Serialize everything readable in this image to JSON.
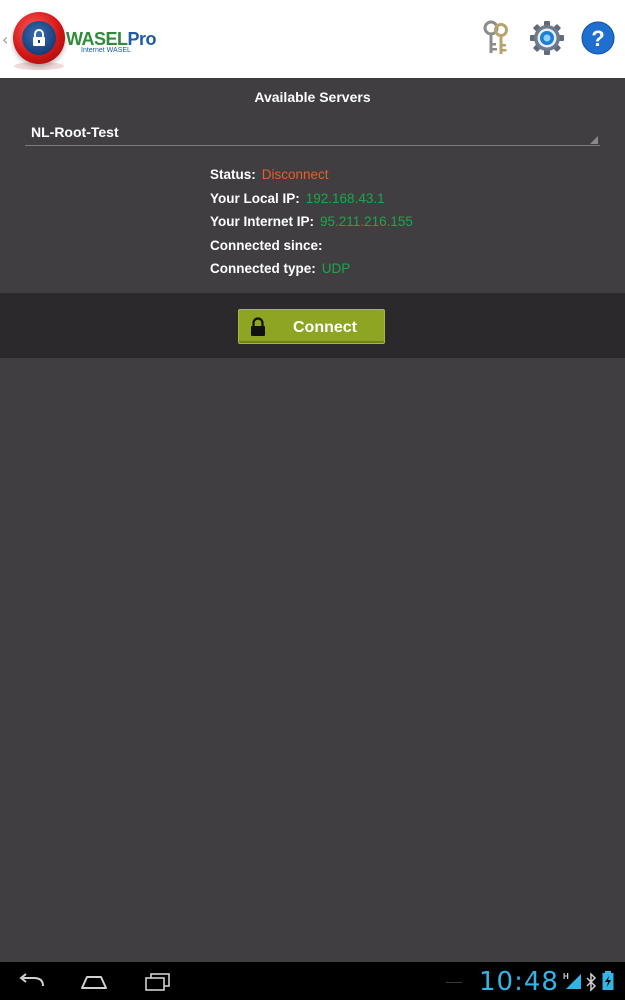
{
  "action_bar": {
    "brand_main": "WASEL",
    "brand_accent": "Pro",
    "brand_subtitle": "Internet WASEL",
    "icons": [
      "keys-icon",
      "gear-icon",
      "help-icon"
    ]
  },
  "server_panel": {
    "title": "Available Servers",
    "selected_server": "NL-Root-Test"
  },
  "info": {
    "status_label": "Status:",
    "status_value": "Disconnect",
    "local_ip_label": "Your Local IP:",
    "local_ip_value": "192.168.43.1",
    "internet_ip_label": "Your Internet IP:",
    "internet_ip_value": "95.211.216.155",
    "since_label": "Connected since:",
    "since_value": "",
    "type_label": "Connected type:",
    "type_value": "UDP"
  },
  "connect": {
    "label": "Connect"
  },
  "status_bar": {
    "clock": "10:48",
    "network": "H"
  },
  "colors": {
    "background": "#403e41",
    "status_red": "#f05a28",
    "value_green": "#1aa84b",
    "button_green": "#8ea524",
    "clock_blue": "#32b4e5"
  }
}
